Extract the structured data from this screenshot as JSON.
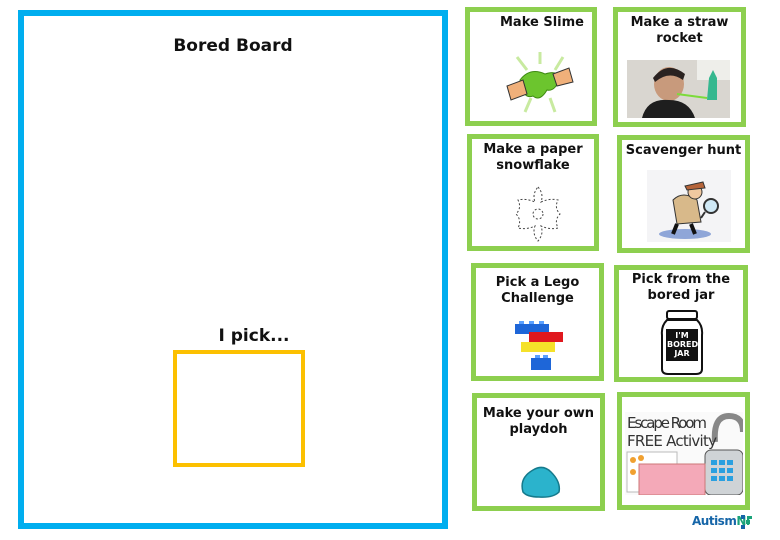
{
  "board": {
    "title": "Bored Board",
    "pick_label": "I pick..."
  },
  "cards": [
    {
      "title": "Make Slime",
      "image": "slime-hands"
    },
    {
      "title": "Make a straw rocket",
      "image": "boy-straw-rocket-photo"
    },
    {
      "title": "Make a paper snowflake",
      "image": "paper-snowflake"
    },
    {
      "title": "Scavenger hunt",
      "image": "detective-magnifier"
    },
    {
      "title": "Pick a Lego Challenge",
      "image": "lego-bricks"
    },
    {
      "title": "Pick from the bored jar",
      "image": "bored-jar",
      "jar_label": "I'M BORED JAR"
    },
    {
      "title": "Make your own playdoh",
      "image": "blue-playdoh"
    },
    {
      "title": "",
      "image": "escape-room-flyer",
      "image_text": "Escape Room FREE Activity"
    }
  ],
  "logo": {
    "name": "Autism",
    "suffix": "NI"
  },
  "colors": {
    "board_border": "#00aeef",
    "pick_border": "#fcc000",
    "card_border": "#8dcf4f",
    "logo_blue": "#1565a8",
    "logo_green": "#1aa37a"
  }
}
